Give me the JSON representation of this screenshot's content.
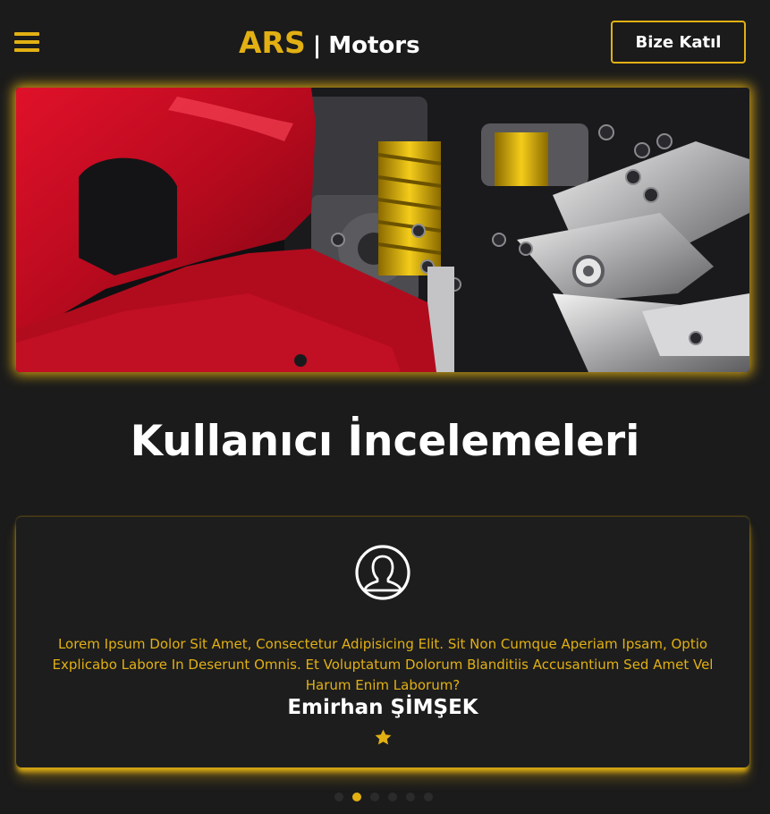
{
  "header": {
    "logo_primary": "ARS",
    "logo_separator": "|",
    "logo_secondary": "Motors",
    "join_button_label": "Bize Katıl",
    "menu_icon": "hamburger-menu-icon"
  },
  "hero": {
    "image_subject": "red sport motorcycle rear suspension close-up"
  },
  "reviews": {
    "section_title": "Kullanıcı İncelemeleri",
    "active_index": 1,
    "slide_count": 6,
    "current": {
      "avatar_icon": "user-avatar-icon",
      "text": "Lorem Ipsum Dolor Sit Amet, Consectetur Adipisicing Elit. Sit Non Cumque Aperiam Ipsam, Optio Explicabo Labore In Deserunt Omnis. Et Voluptatum Dolorum Blanditiis Accusantium Sed Amet Vel Harum Enim Laborum?",
      "author": "Emirhan ŞİMŞEK",
      "rating": 1,
      "rating_icon": "star-icon"
    }
  },
  "colors": {
    "accent": "#e2b013",
    "background": "#1b1b1b",
    "text": "#ffffff"
  }
}
